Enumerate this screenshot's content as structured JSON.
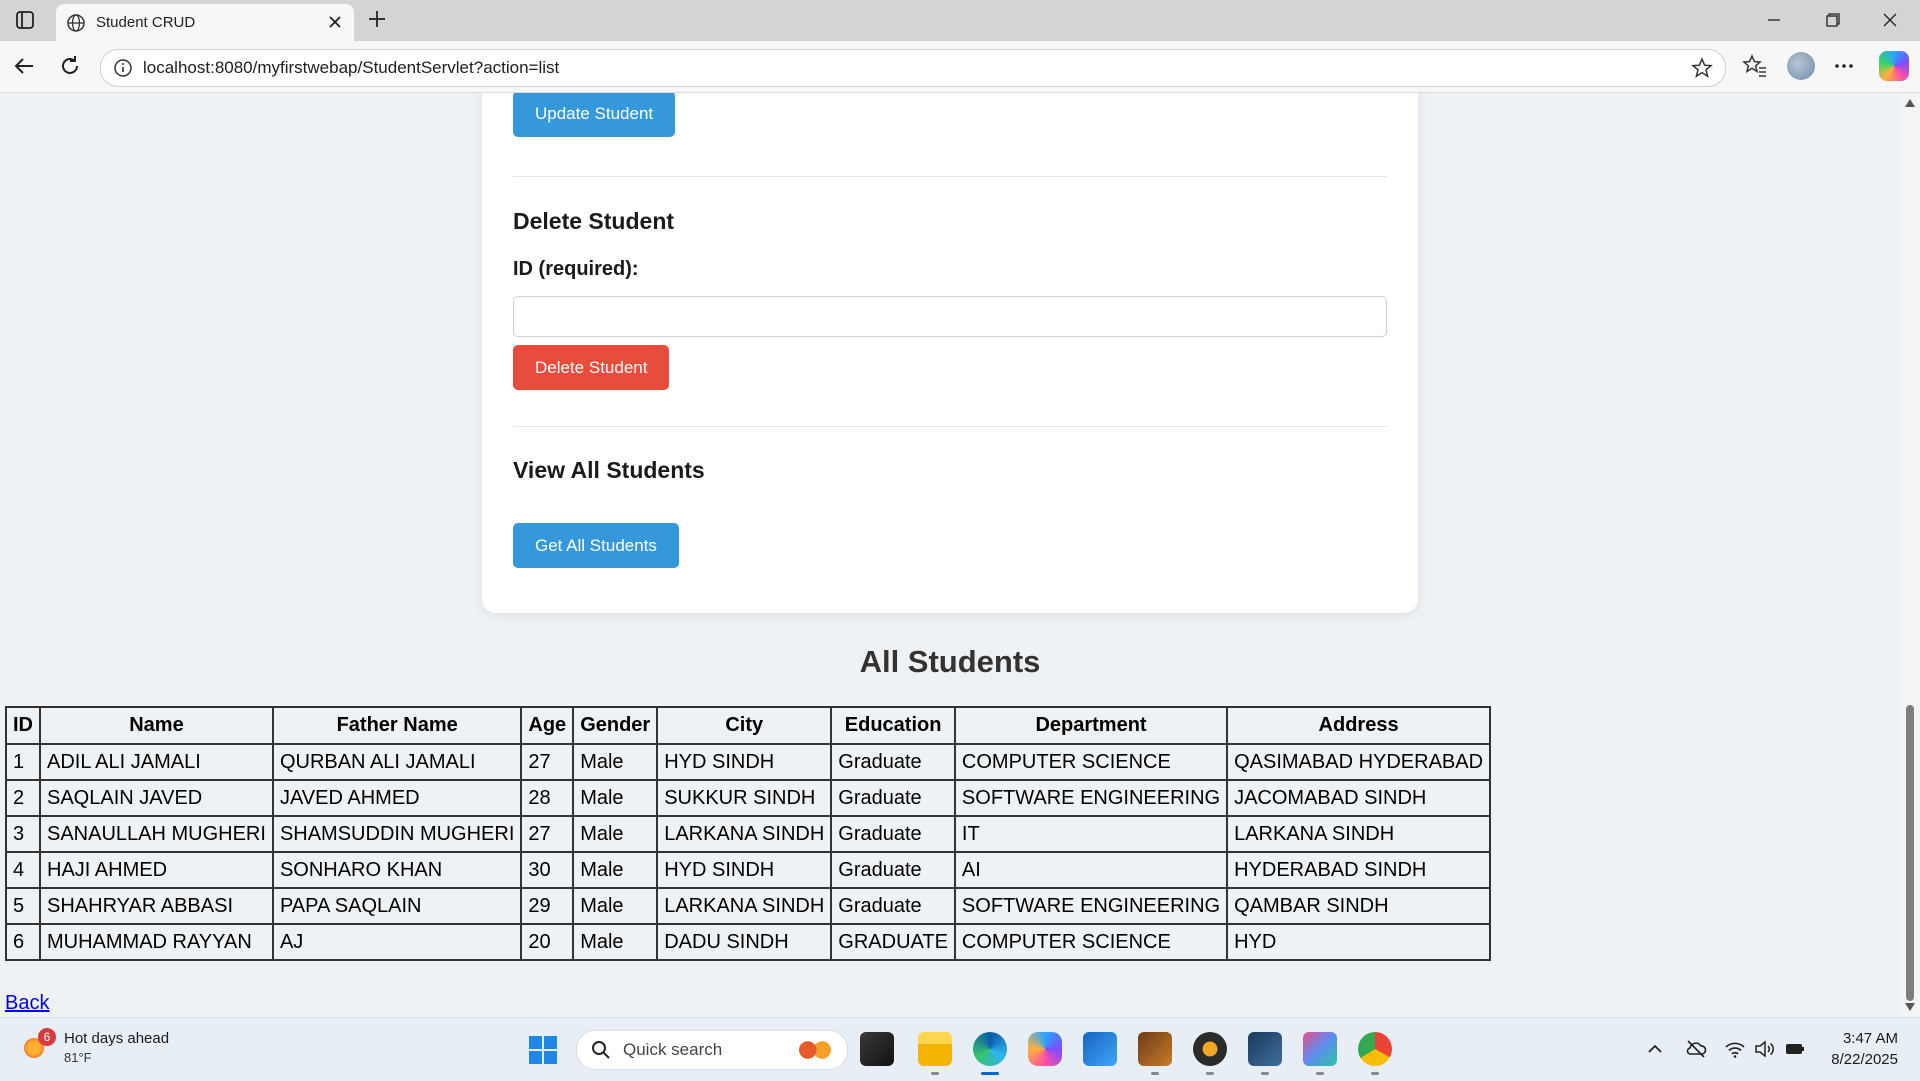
{
  "browser": {
    "tab_title": "Student CRUD",
    "url": "localhost:8080/myfirstwebap/StudentServlet?action=list"
  },
  "update_section": {
    "button_label": "Update Student"
  },
  "delete_section": {
    "title": "Delete Student",
    "id_label": "ID (required):",
    "id_value": "",
    "button_label": "Delete Student"
  },
  "view_section": {
    "title": "View All Students",
    "button_label": "Get All Students"
  },
  "list": {
    "title": "All Students",
    "columns": [
      "ID",
      "Name",
      "Father Name",
      "Age",
      "Gender",
      "City",
      "Education",
      "Department",
      "Address"
    ],
    "rows": [
      [
        "1",
        "ADIL ALI JAMALI",
        "QURBAN ALI JAMALI",
        "27",
        "Male",
        "HYD SINDH",
        "Graduate",
        "COMPUTER SCIENCE",
        "QASIMABAD HYDERABAD"
      ],
      [
        "2",
        "SAQLAIN JAVED",
        "JAVED AHMED",
        "28",
        "Male",
        "SUKKUR SINDH",
        "Graduate",
        "SOFTWARE ENGINEERING",
        "JACOMABAD SINDH"
      ],
      [
        "3",
        "SANAULLAH MUGHERI",
        "SHAMSUDDIN MUGHERI",
        "27",
        "Male",
        "LARKANA SINDH",
        "Graduate",
        "IT",
        "LARKANA SINDH"
      ],
      [
        "4",
        "HAJI AHMED",
        "SONHARO KHAN",
        "30",
        "Male",
        "HYD SINDH",
        "Graduate",
        "AI",
        "HYDERABAD SINDH"
      ],
      [
        "5",
        "SHAHRYAR ABBASI",
        "PAPA SAQLAIN",
        "29",
        "Male",
        "LARKANA SINDH",
        "Graduate",
        "SOFTWARE ENGINEERING",
        "QAMBAR SINDH"
      ],
      [
        "6",
        "MUHAMMAD RAYYAN",
        "AJ",
        "20",
        "Male",
        "DADU SINDH",
        "GRADUATE",
        "COMPUTER SCIENCE",
        "HYD"
      ]
    ],
    "back_link": "Back"
  },
  "taskbar": {
    "weather_badge": "6",
    "weather_title": "Hot days ahead",
    "weather_temp": "81°F",
    "search_placeholder": "Quick search",
    "time": "3:47 AM",
    "date": "8/22/2025"
  },
  "colors": {
    "primary_button": "#3498db",
    "danger_button": "#e74c3c",
    "page_background": "#eef2f5"
  }
}
